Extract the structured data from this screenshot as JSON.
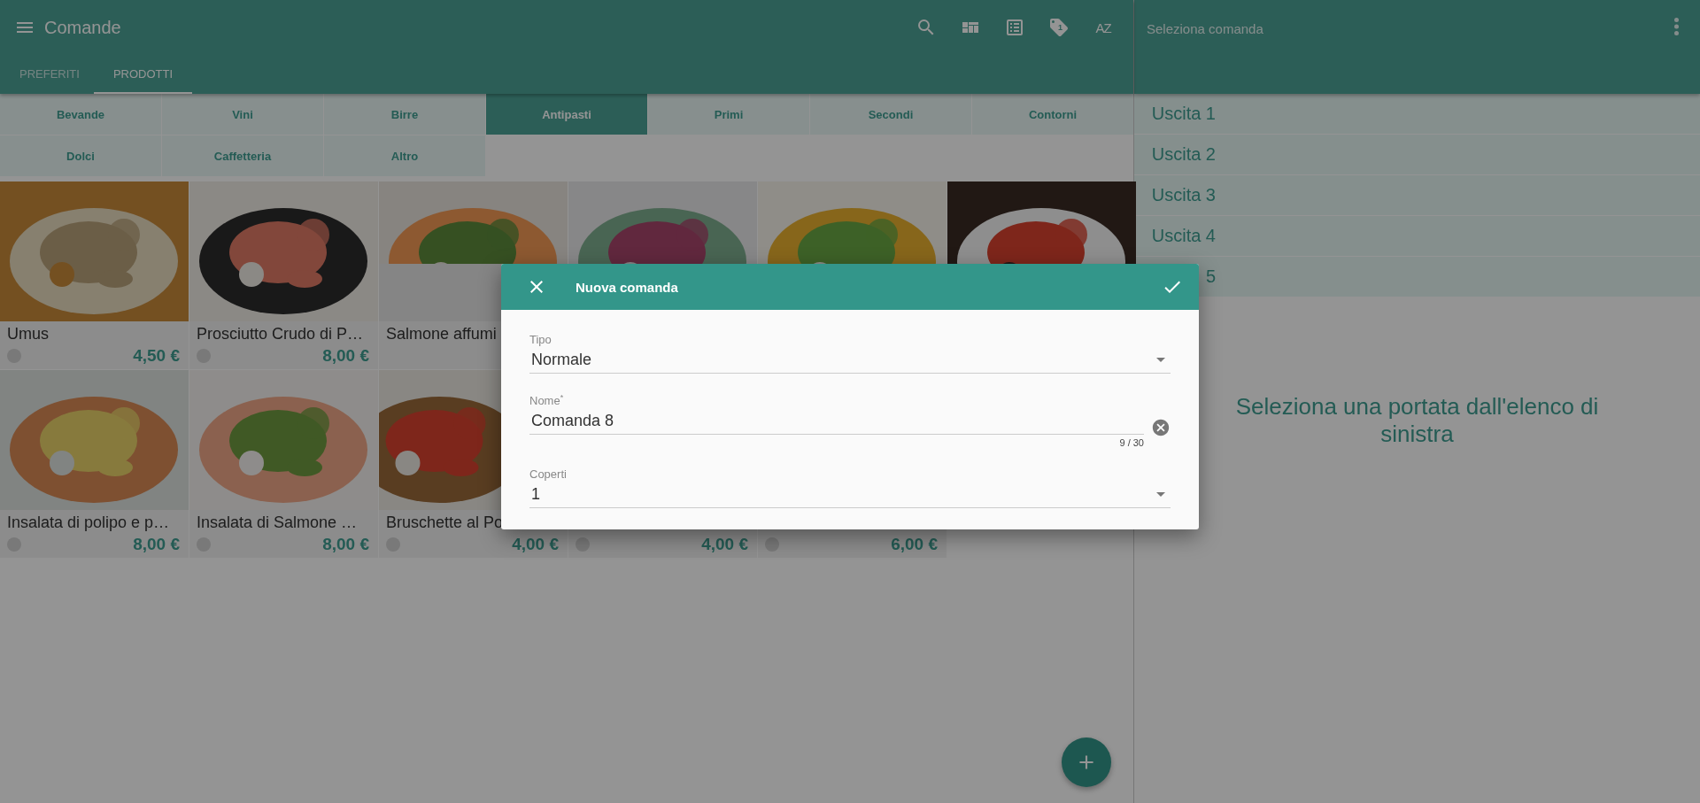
{
  "app_bar": {
    "title": "Comande",
    "tag_count": "1",
    "sort_label": "AZ"
  },
  "tabs": [
    {
      "label": "PREFERITI",
      "selected": false
    },
    {
      "label": "PRODOTTI",
      "selected": true
    }
  ],
  "categories": [
    {
      "label": "Bevande",
      "selected": false
    },
    {
      "label": "Vini",
      "selected": false
    },
    {
      "label": "Birre",
      "selected": false
    },
    {
      "label": "Antipasti",
      "selected": true
    },
    {
      "label": "Primi",
      "selected": false
    },
    {
      "label": "Secondi",
      "selected": false
    },
    {
      "label": "Contorni",
      "selected": false
    },
    {
      "label": "Dolci",
      "selected": false
    },
    {
      "label": "Caffetteria",
      "selected": false
    },
    {
      "label": "Altro",
      "selected": false
    }
  ],
  "products": [
    {
      "kind": "picture",
      "name": "Umus",
      "price": "4,50 €"
    },
    {
      "kind": "picture",
      "name": "Prosciutto Crudo di P…",
      "price": "8,00 €"
    },
    {
      "kind": "picture",
      "name": "Salmone affumi"
    },
    {
      "kind": "picture"
    },
    {
      "kind": "picture"
    },
    {
      "kind": "picture"
    },
    {
      "kind": "picture",
      "name": "Insalata di polipo e p…",
      "price": "8,00 €"
    },
    {
      "kind": "picture",
      "name": "Insalata di Salmone …",
      "price": "8,00 €"
    },
    {
      "kind": "picture",
      "name": "Bruschette al Po",
      "price": "4,00 €"
    },
    {
      "price": "4,00 €"
    },
    {
      "price": "6,00 €"
    }
  ],
  "order_panel": {
    "title": "Seleziona comanda",
    "items": [
      "Uscita 1",
      "Uscita 2",
      "Uscita 3",
      "Uscita 4",
      "5"
    ],
    "message": "Seleziona una portata dall'elenco di sinistra"
  },
  "dialog": {
    "title": "Nuova comanda",
    "fields": [
      {
        "kind": "select",
        "label": "Tipo",
        "value": "Normale"
      },
      {
        "kind": "text",
        "label": "Nome$^{*}$",
        "value": "Comanda 8",
        "counter": "9 / 30"
      },
      {
        "kind": "select",
        "label": "Coperti",
        "value": "1"
      }
    ]
  }
}
